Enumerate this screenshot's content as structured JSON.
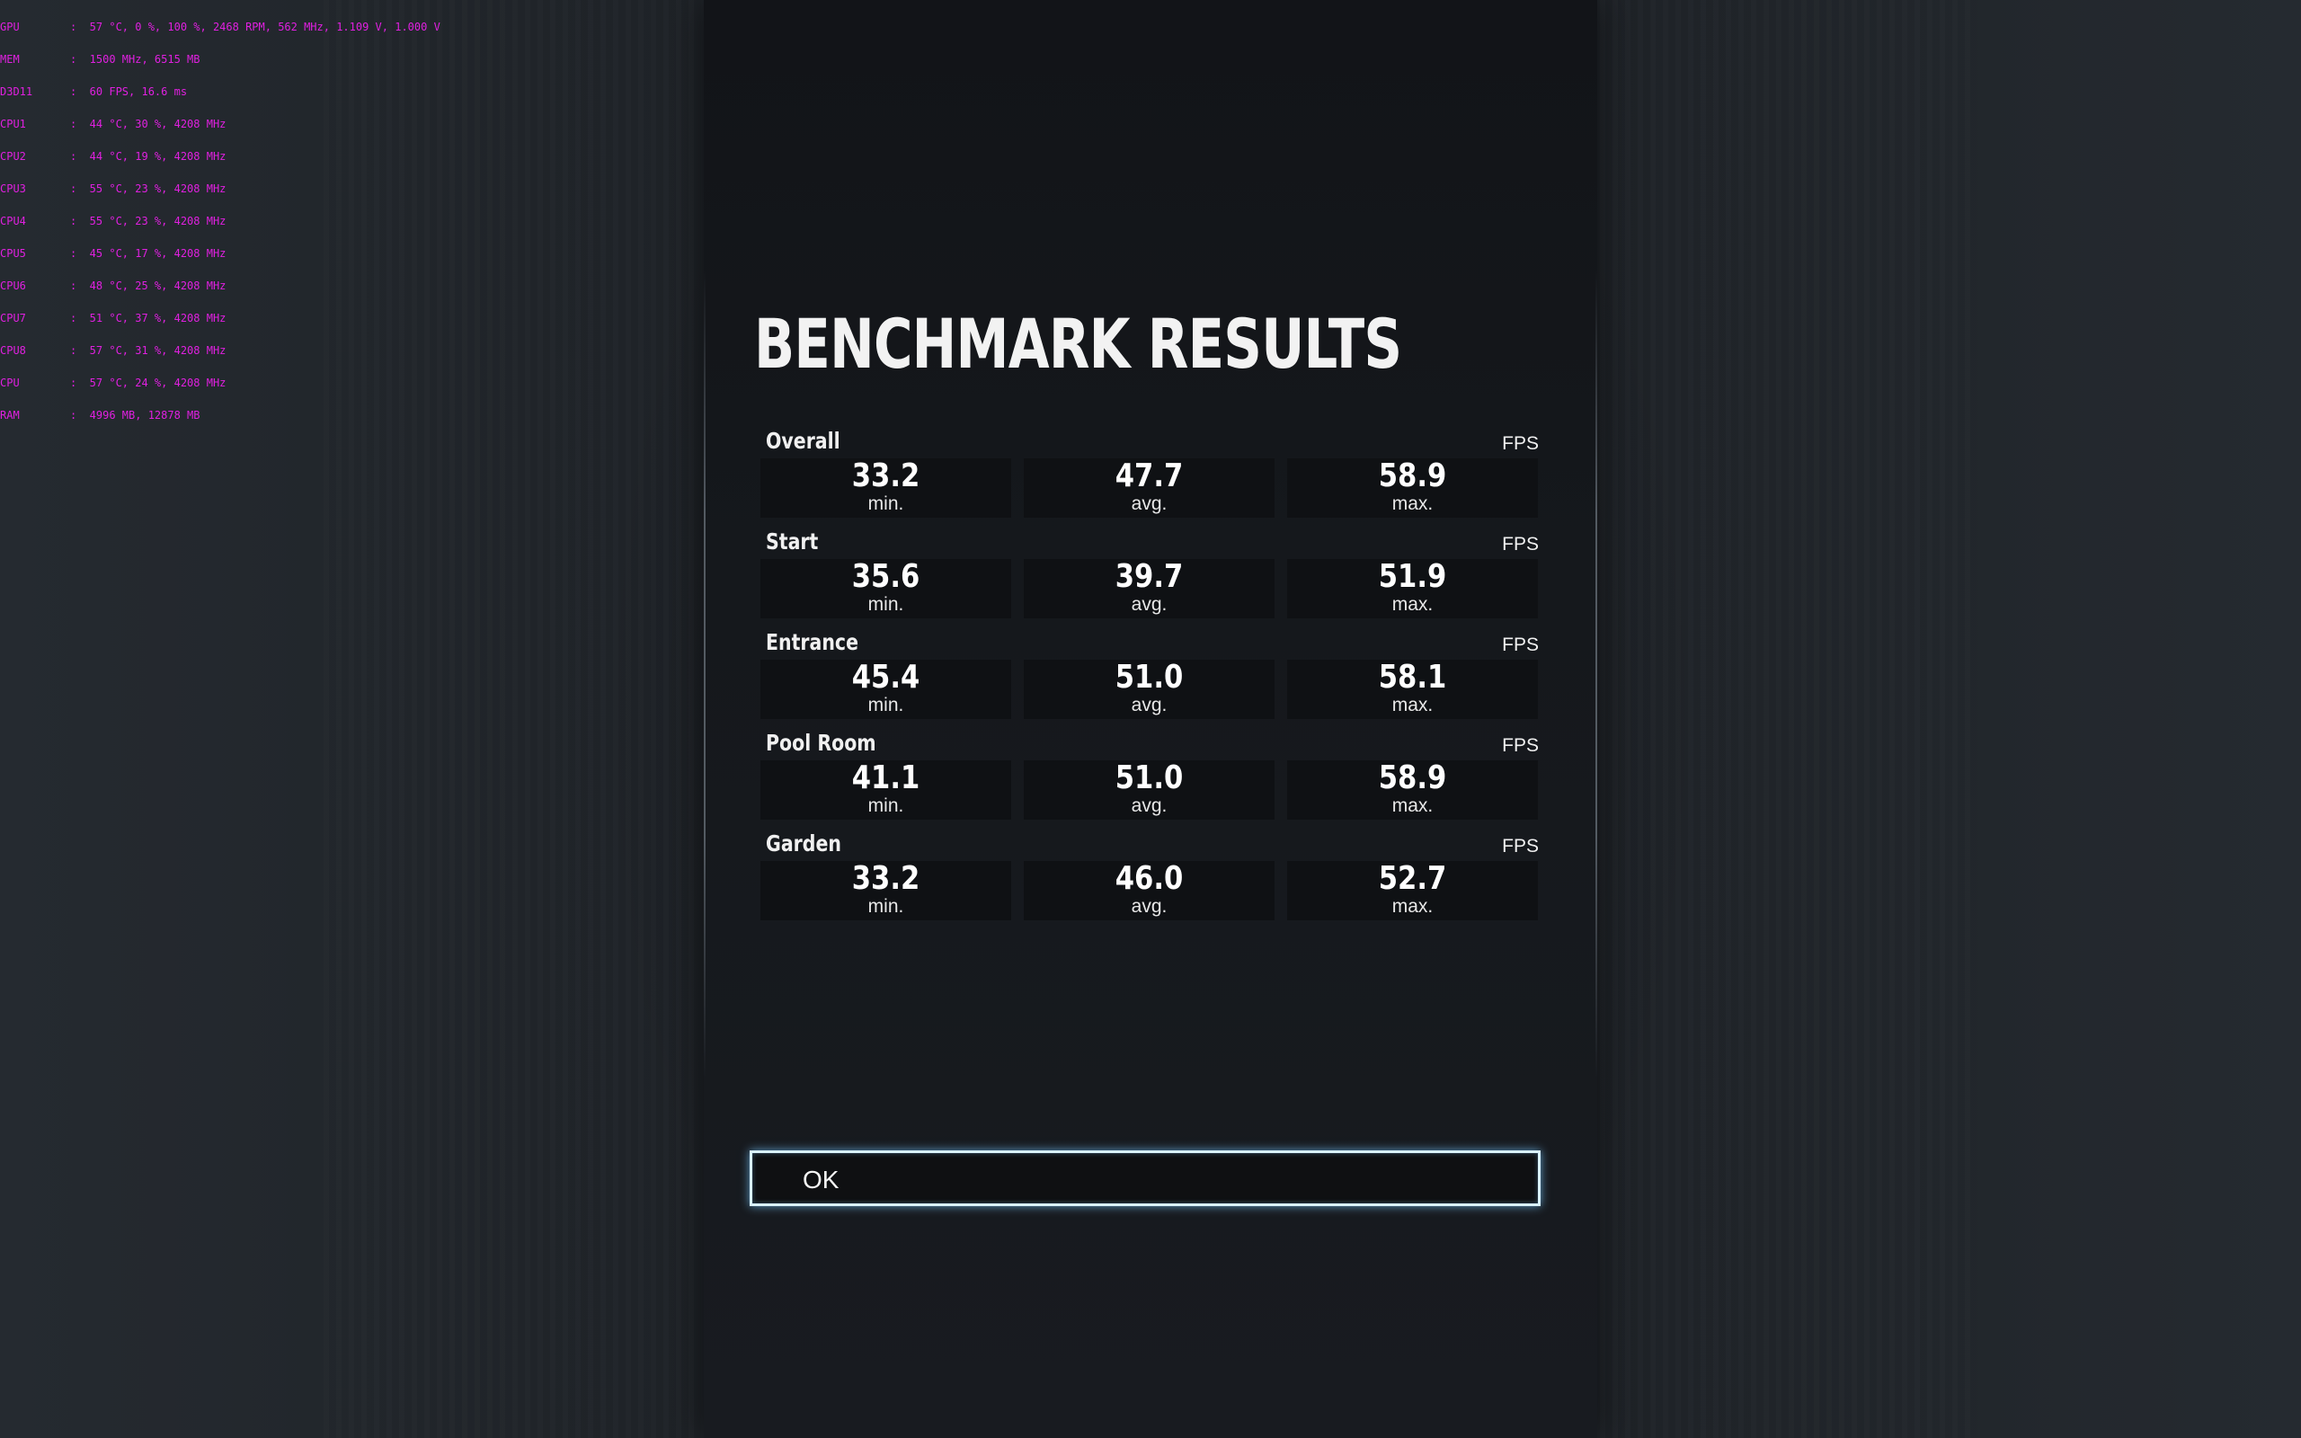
{
  "overlay": {
    "lines": [
      {
        "key": "GPU",
        "value": ":  57 °C, 0 %, 100 %, 2468 RPM, 562 MHz, 1.109 V, 1.000 V"
      },
      {
        "key": "MEM",
        "value": ":  1500 MHz, 6515 MB"
      },
      {
        "key": "D3D11",
        "value": ":  60 FPS, 16.6 ms"
      },
      {
        "key": "CPU1",
        "value": ":  44 °C, 30 %, 4208 MHz"
      },
      {
        "key": "CPU2",
        "value": ":  44 °C, 19 %, 4208 MHz"
      },
      {
        "key": "CPU3",
        "value": ":  55 °C, 23 %, 4208 MHz"
      },
      {
        "key": "CPU4",
        "value": ":  55 °C, 23 %, 4208 MHz"
      },
      {
        "key": "CPU5",
        "value": ":  45 °C, 17 %, 4208 MHz"
      },
      {
        "key": "CPU6",
        "value": ":  48 °C, 25 %, 4208 MHz"
      },
      {
        "key": "CPU7",
        "value": ":  51 °C, 37 %, 4208 MHz"
      },
      {
        "key": "CPU8",
        "value": ":  57 °C, 31 %, 4208 MHz"
      },
      {
        "key": "CPU",
        "value": ":  57 °C, 24 %, 4208 MHz"
      },
      {
        "key": "RAM",
        "value": ":  4996 MB, 12878 MB"
      }
    ]
  },
  "title": "BENCHMARK RESULTS",
  "unit": "FPS",
  "labels": {
    "min": "min.",
    "avg": "avg.",
    "max": "max."
  },
  "sections": [
    {
      "name": "Overall",
      "min": "33.2",
      "avg": "47.7",
      "max": "58.9"
    },
    {
      "name": "Start",
      "min": "35.6",
      "avg": "39.7",
      "max": "51.9"
    },
    {
      "name": "Entrance",
      "min": "45.4",
      "avg": "51.0",
      "max": "58.1"
    },
    {
      "name": "Pool Room",
      "min": "41.1",
      "avg": "51.0",
      "max": "58.9"
    },
    {
      "name": "Garden",
      "min": "33.2",
      "avg": "46.0",
      "max": "52.7"
    }
  ],
  "ok_button": {
    "label": "OK"
  },
  "colors": {
    "overlay": "#e020e0",
    "button_glow": "#78c8ff",
    "panel": "#15181c",
    "text": "#ffffff"
  }
}
